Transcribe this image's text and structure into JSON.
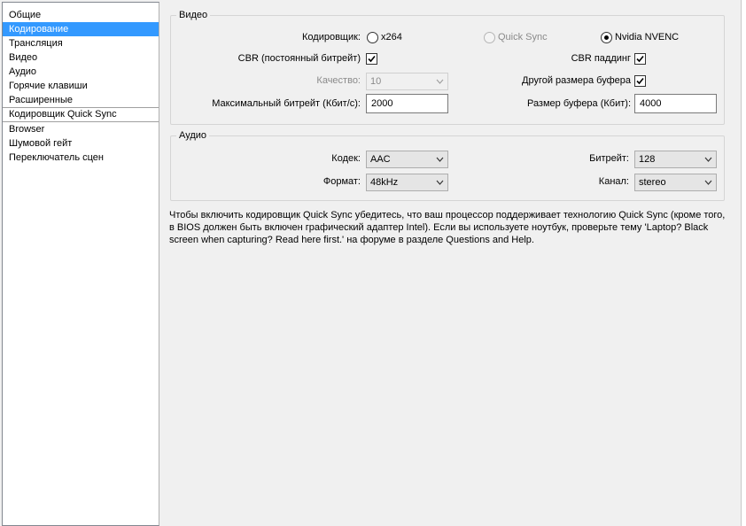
{
  "sidebar": {
    "items": [
      "Общие",
      "Кодирование",
      "Трансляция",
      "Видео",
      "Аудио",
      "Горячие клавиши",
      "Расширенные"
    ],
    "quick_sync_item": "Кодировщик Quick Sync",
    "extra_items": [
      "Browser",
      "Шумовой гейт",
      "Переключатель сцен"
    ],
    "selected_index": 1
  },
  "video": {
    "title": "Видео",
    "encoder_label": "Кодировщик:",
    "encoder_options": [
      "x264",
      "Quick Sync",
      "Nvidia NVENC"
    ],
    "encoder_selected": "Nvidia NVENC",
    "cbr_label": "CBR (постоянный битрейт)",
    "cbr_checked": true,
    "cbr_padding_label": "CBR паддинг",
    "cbr_padding_checked": true,
    "quality_label": "Качество:",
    "quality_value": "10",
    "custom_buffer_label": "Другой размера буфера",
    "custom_buffer_checked": true,
    "max_bitrate_label": "Максимальный битрейт (Кбит/с):",
    "max_bitrate_value": "2000",
    "buffer_size_label": "Размер буфера (Кбит):",
    "buffer_size_value": "4000"
  },
  "audio": {
    "title": "Аудио",
    "codec_label": "Кодек:",
    "codec_value": "AAC",
    "bitrate_label": "Битрейт:",
    "bitrate_value": "128",
    "format_label": "Формат:",
    "format_value": "48kHz",
    "channel_label": "Канал:",
    "channel_value": "stereo"
  },
  "info_text": "Чтобы включить кодировщик Quick Sync убедитесь, что ваш процессор поддерживает технологию Quick Sync (кроме того, в BIOS должен быть включен графический адаптер Intel). Если вы используете ноутбук, проверьте тему 'Laptop? Black screen when capturing? Read here first.' на форуме в разделе Questions and Help."
}
